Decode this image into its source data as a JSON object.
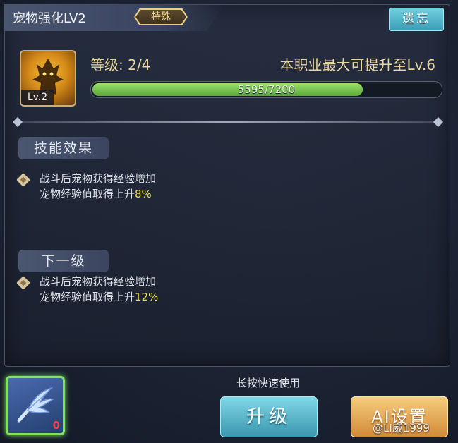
{
  "title": {
    "text": "宠物强化LV2",
    "tag": "特殊"
  },
  "forget_button": "遗忘",
  "pet": {
    "level_badge": "Lv.2"
  },
  "stats": {
    "level_label": "等级: 2/4",
    "max_level": "本职业最大可提升至Lv.6",
    "exp_text": "5595/7200",
    "exp_fraction": 0.777
  },
  "current": {
    "label": "技能效果",
    "line1": "战斗后宠物获得经验增加",
    "line2_prefix": "宠物经验值取得上升",
    "line2_value": "8%"
  },
  "next": {
    "label": "下一级",
    "line1": "战斗后宠物获得经验增加",
    "line2_prefix": "宠物经验值取得上升",
    "line2_value": "12%"
  },
  "item": {
    "count": "0"
  },
  "hint": "长按快速使用",
  "buttons": {
    "upgrade": "升级",
    "ai": "AI设置"
  },
  "watermark": "@LI威1999",
  "colors": {
    "accent_green": "#7fe35a",
    "highlight_yellow": "#f0e040"
  }
}
